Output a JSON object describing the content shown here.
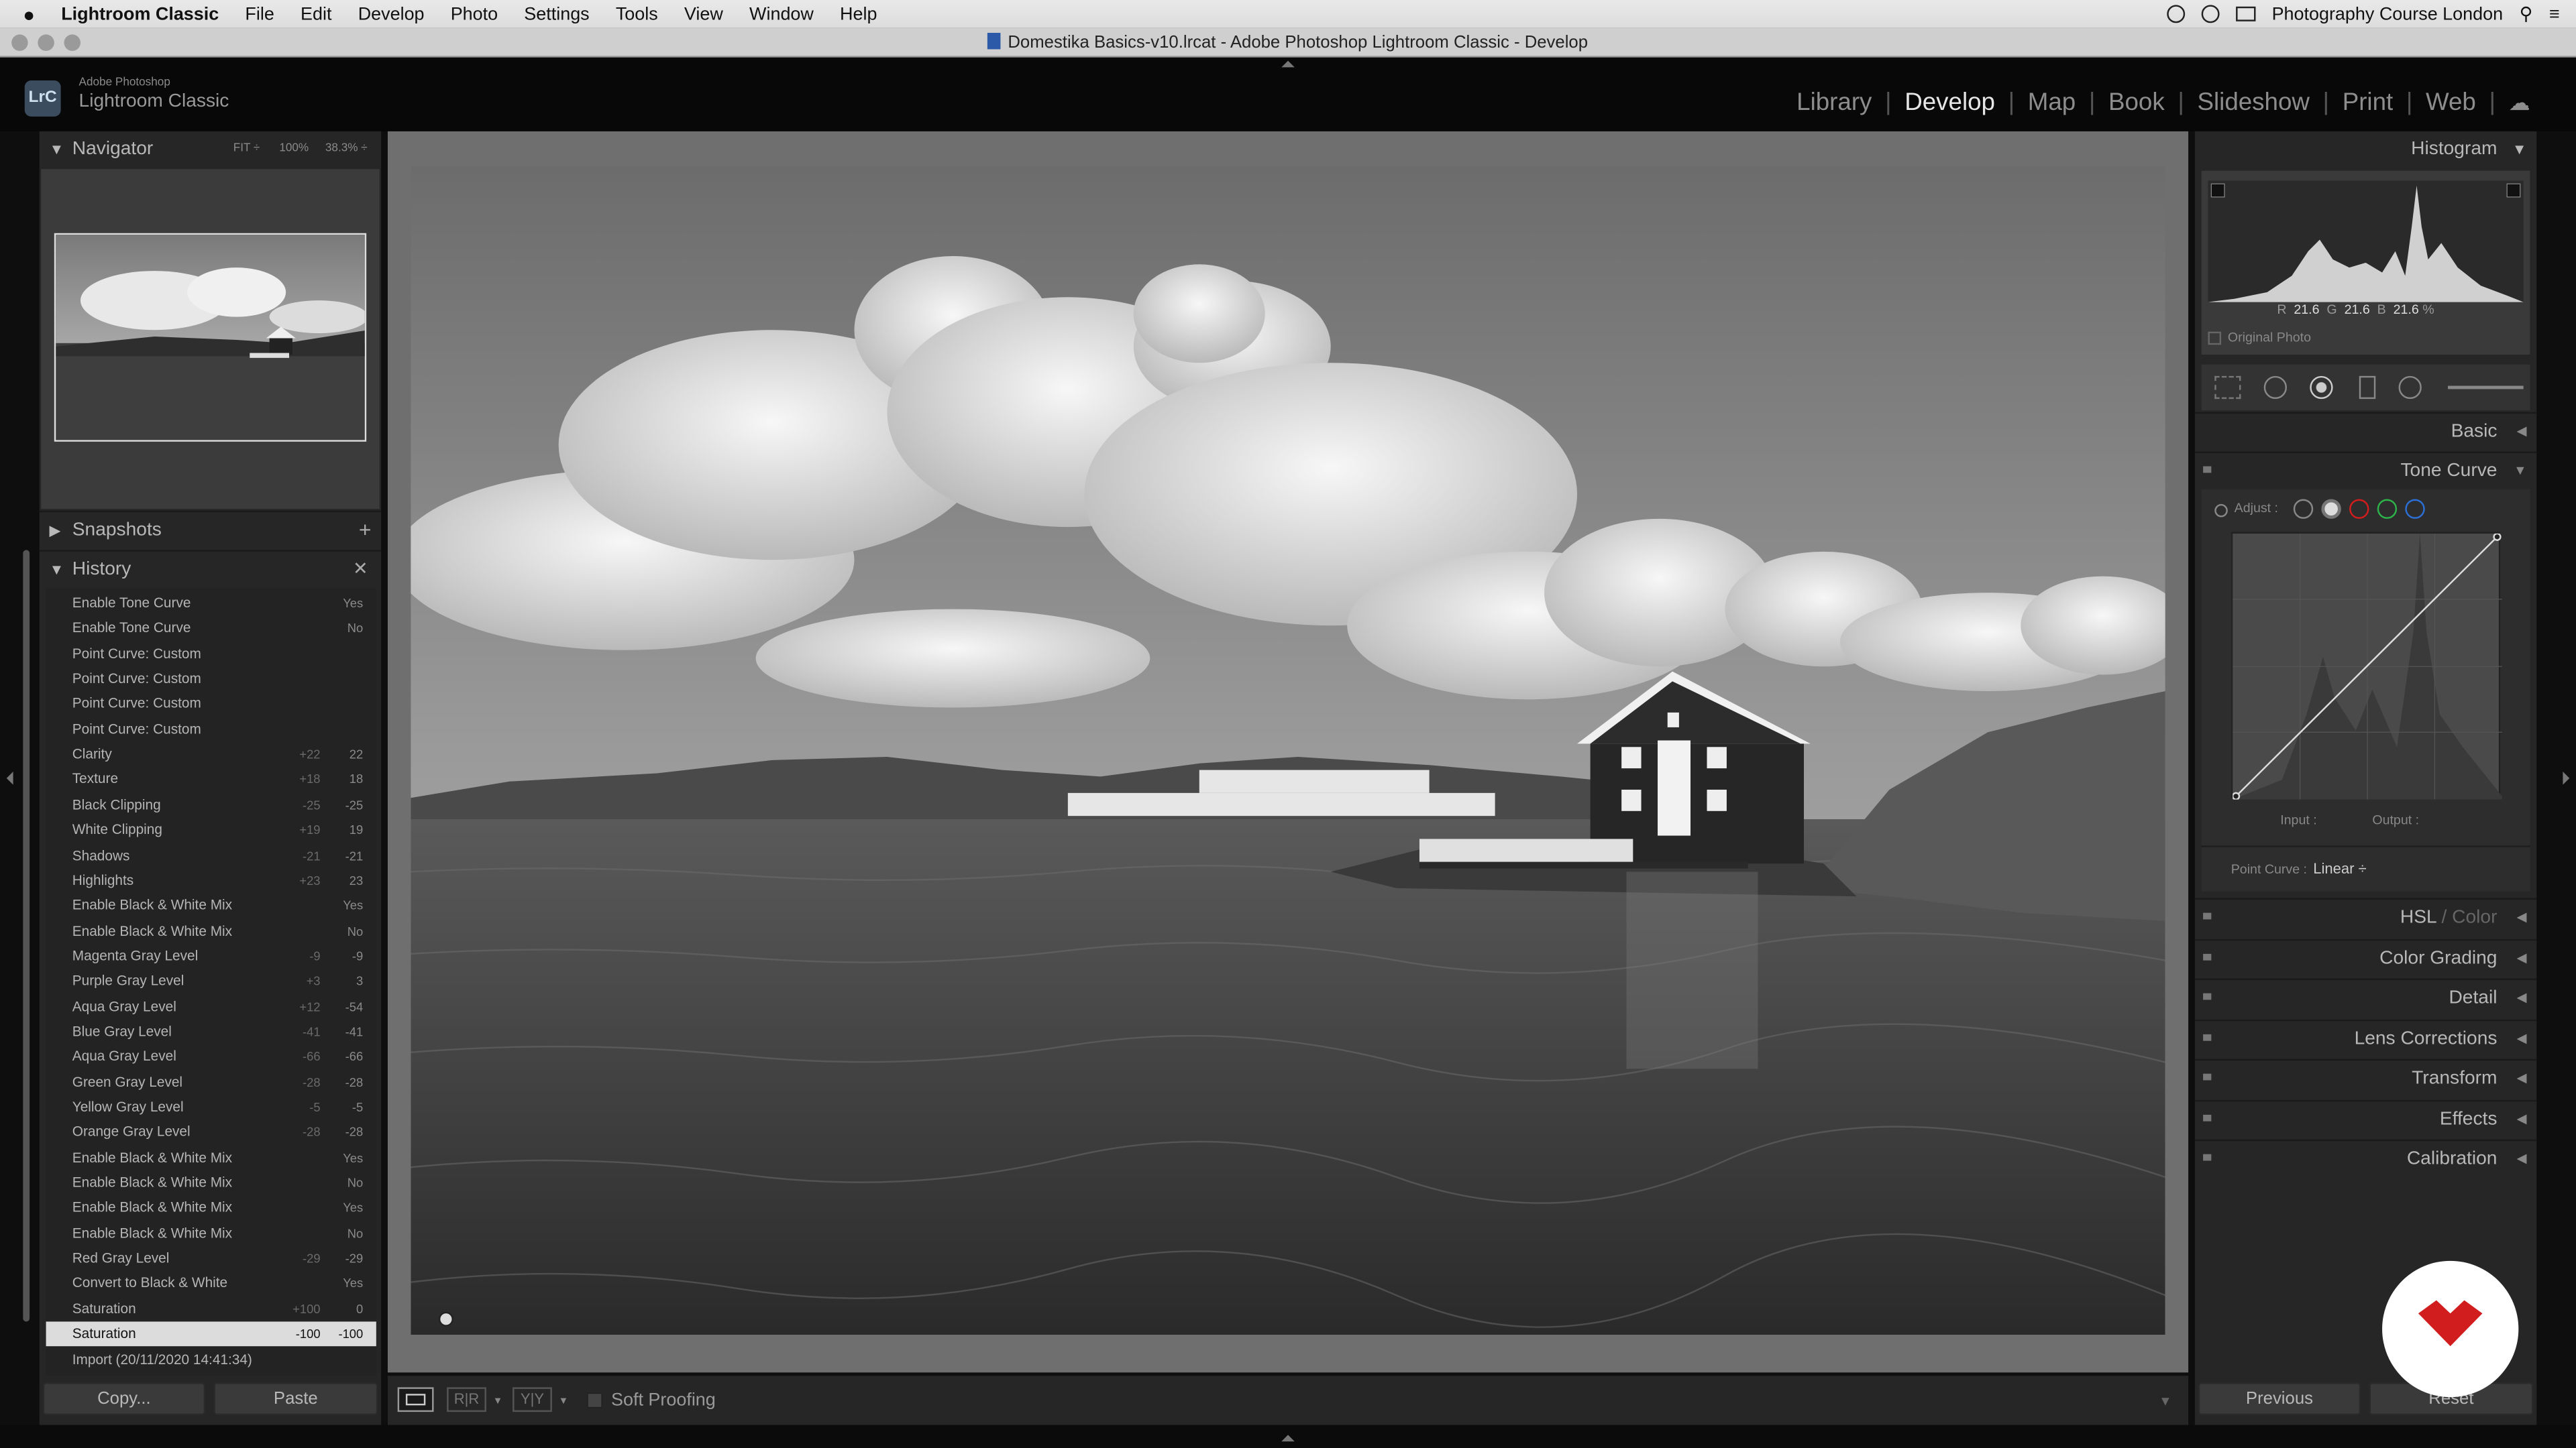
{
  "menubar": {
    "apple": "",
    "app": "Lightroom Classic",
    "items": [
      "File",
      "Edit",
      "Develop",
      "Photo",
      "Settings",
      "Tools",
      "View",
      "Window",
      "Help"
    ],
    "right_text": "Photography Course London"
  },
  "window": {
    "title": "Domestika Basics-v10.lrcat - Adobe Photoshop Lightroom Classic - Develop"
  },
  "identity": {
    "badge": "LrC",
    "line1": "Adobe Photoshop",
    "line2": "Lightroom Classic"
  },
  "modules": [
    {
      "label": "Library",
      "active": false
    },
    {
      "label": "Develop",
      "active": true
    },
    {
      "label": "Map",
      "active": false
    },
    {
      "label": "Book",
      "active": false
    },
    {
      "label": "Slideshow",
      "active": false
    },
    {
      "label": "Print",
      "active": false
    },
    {
      "label": "Web",
      "active": false
    }
  ],
  "navigator": {
    "title": "Navigator",
    "zoom": [
      "FIT ÷",
      "100%",
      "38.3% ÷"
    ]
  },
  "snapshots": {
    "title": "Snapshots"
  },
  "history": {
    "title": "History",
    "rows": [
      {
        "name": "Enable Tone Curve",
        "before": "",
        "after": "Yes"
      },
      {
        "name": "Enable Tone Curve",
        "before": "",
        "after": "No"
      },
      {
        "name": "Point Curve: Custom",
        "before": "",
        "after": ""
      },
      {
        "name": "Point Curve: Custom",
        "before": "",
        "after": ""
      },
      {
        "name": "Point Curve: Custom",
        "before": "",
        "after": ""
      },
      {
        "name": "Point Curve: Custom",
        "before": "",
        "after": ""
      },
      {
        "name": "Clarity",
        "before": "+22",
        "after": "22"
      },
      {
        "name": "Texture",
        "before": "+18",
        "after": "18"
      },
      {
        "name": "Black Clipping",
        "before": "-25",
        "after": "-25"
      },
      {
        "name": "White Clipping",
        "before": "+19",
        "after": "19"
      },
      {
        "name": "Shadows",
        "before": "-21",
        "after": "-21"
      },
      {
        "name": "Highlights",
        "before": "+23",
        "after": "23"
      },
      {
        "name": "Enable Black & White Mix",
        "before": "",
        "after": "Yes"
      },
      {
        "name": "Enable Black & White Mix",
        "before": "",
        "after": "No"
      },
      {
        "name": "Magenta Gray Level",
        "before": "-9",
        "after": "-9"
      },
      {
        "name": "Purple Gray Level",
        "before": "+3",
        "after": "3"
      },
      {
        "name": "Aqua Gray Level",
        "before": "+12",
        "after": "-54"
      },
      {
        "name": "Blue Gray Level",
        "before": "-41",
        "after": "-41"
      },
      {
        "name": "Aqua Gray Level",
        "before": "-66",
        "after": "-66"
      },
      {
        "name": "Green Gray Level",
        "before": "-28",
        "after": "-28"
      },
      {
        "name": "Yellow Gray Level",
        "before": "-5",
        "after": "-5"
      },
      {
        "name": "Orange Gray Level",
        "before": "-28",
        "after": "-28"
      },
      {
        "name": "Enable Black & White Mix",
        "before": "",
        "after": "Yes"
      },
      {
        "name": "Enable Black & White Mix",
        "before": "",
        "after": "No"
      },
      {
        "name": "Enable Black & White Mix",
        "before": "",
        "after": "Yes"
      },
      {
        "name": "Enable Black & White Mix",
        "before": "",
        "after": "No"
      },
      {
        "name": "Red Gray Level",
        "before": "-29",
        "after": "-29"
      },
      {
        "name": "Convert to Black & White",
        "before": "",
        "after": "Yes"
      },
      {
        "name": "Saturation",
        "before": "+100",
        "after": "0"
      },
      {
        "name": "Saturation",
        "before": "-100",
        "after": "-100",
        "selected": true
      },
      {
        "name": "Import (20/11/2020 14:41:34)",
        "before": "",
        "after": ""
      }
    ]
  },
  "left_buttons": {
    "copy": "Copy...",
    "paste": "Paste"
  },
  "toolbar": {
    "soft_proofing": "Soft Proofing",
    "before_after_1": "R|R",
    "before_after_2": "Y|Y"
  },
  "histogram": {
    "title": "Histogram",
    "r_label": "R",
    "r": "21.6",
    "g_label": "G",
    "g": "21.6",
    "b_label": "B",
    "b": "21.6",
    "pct": "%",
    "original_photo": "Original Photo"
  },
  "sections": {
    "basic": "Basic",
    "tone_curve": "Tone Curve",
    "hsl": "HSL",
    "hsl_sep": " / ",
    "hsl_color": "Color",
    "color_grading": "Color Grading",
    "detail": "Detail",
    "lens": "Lens Corrections",
    "transform": "Transform",
    "effects": "Effects",
    "calibration": "Calibration"
  },
  "tone_curve": {
    "adjust": "Adjust :",
    "input": "Input :",
    "output": "Output :",
    "point_curve_label": "Point Curve :",
    "point_curve_value": "Linear ÷"
  },
  "right_buttons": {
    "previous": "Previous",
    "reset": "Reset"
  },
  "colors": {
    "accent_red": "#d11d1d",
    "panel": "#262626",
    "canvas": "#6f6f6f"
  }
}
